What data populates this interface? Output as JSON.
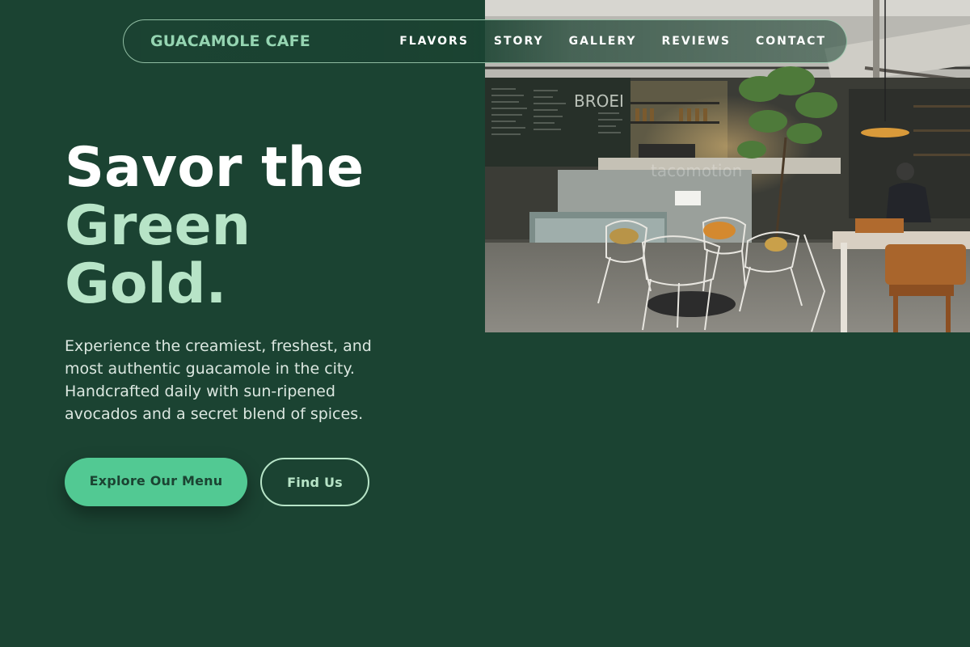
{
  "nav": {
    "brand": "GUACAMOLE CAFE",
    "links": [
      "FLAVORS",
      "STORY",
      "GALLERY",
      "REVIEWS",
      "CONTACT"
    ]
  },
  "hero": {
    "title_line1": "Savor the",
    "title_line2": "Green",
    "title_line3": "Gold.",
    "description": "Experience the creamiest, freshest, and most authentic guacamole in the city. Handcrafted daily with sun-ripened avocados and a secret blend of spices.",
    "primary_cta": "Explore Our Menu",
    "secondary_cta": "Find Us"
  },
  "image": {
    "kind": "cafe-interior-photo",
    "sign_text": "BROEI",
    "watermark": "tacomotion"
  },
  "colors": {
    "background": "#1b4332",
    "accent_light": "#b7e4c7",
    "brand": "#95d5b2",
    "button": "#52c993"
  }
}
